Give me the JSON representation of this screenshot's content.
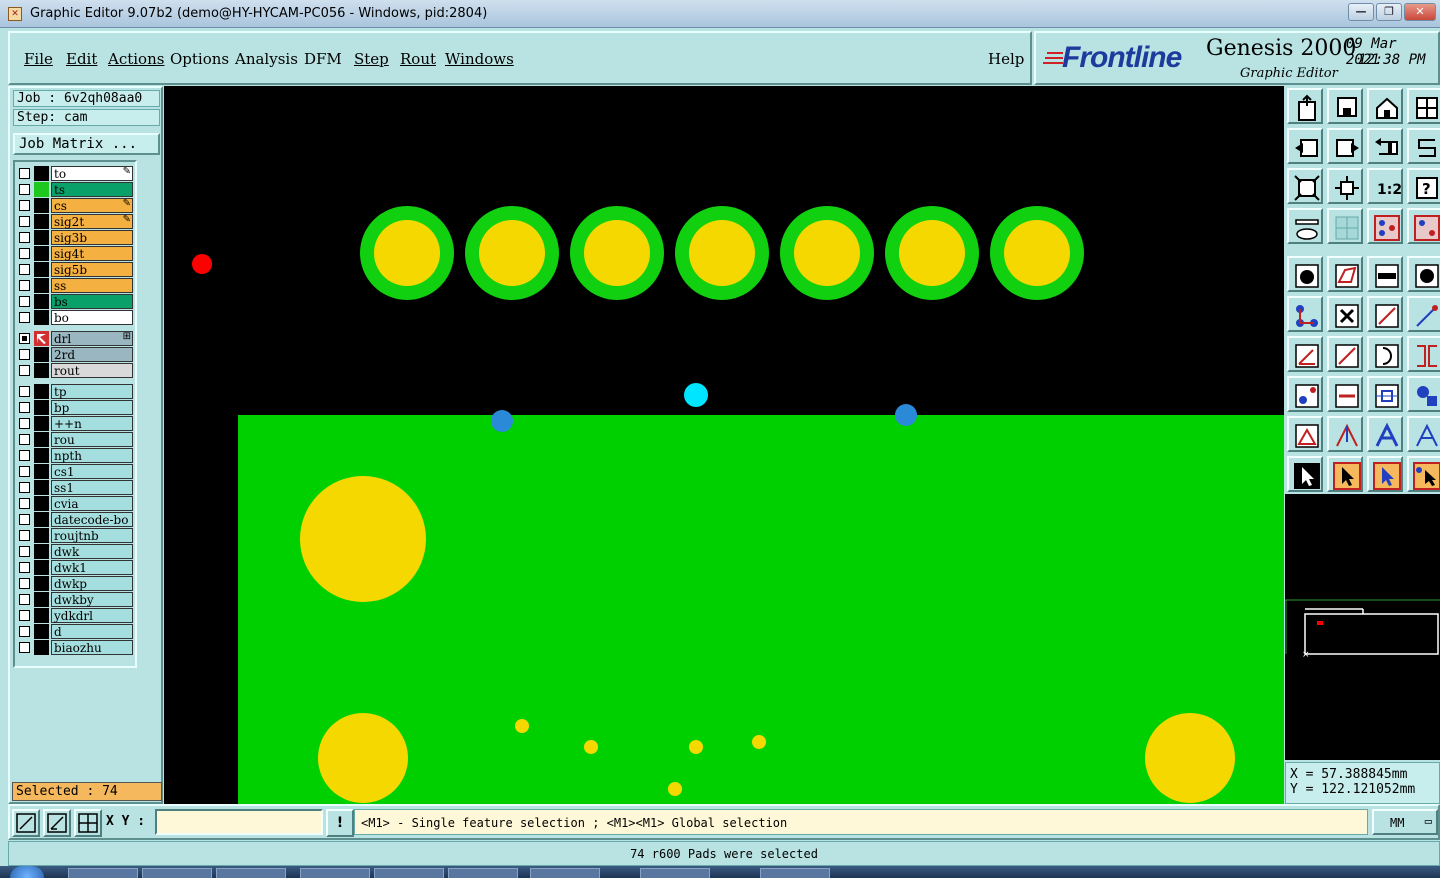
{
  "window": {
    "title": "Graphic Editor 9.07b2 (demo@HY-HYCAM-PC056 - Windows, pid:2804)",
    "minimize_label": "—",
    "maximize_label": "❐",
    "close_label": "✕",
    "close_color": "#c9473b"
  },
  "menu": {
    "file": "File",
    "edit": "Edit",
    "actions": "Actions",
    "options": "Options",
    "analysis": "Analysis",
    "dfm": "DFM",
    "step": "Step",
    "rout": "Rout",
    "windows": "Windows",
    "help": "Help"
  },
  "brand": {
    "logo": "Frontline",
    "product": "Genesis 2000",
    "subtitle": "Graphic Editor",
    "date": "09 Mar 2021",
    "time": "12:38 PM",
    "logo_color": "#1d3b9c"
  },
  "job": {
    "job_label": "Job : 6v2qh08aa0",
    "step_label": "Step: cam",
    "matrix_button": "Job Matrix ..."
  },
  "layers": {
    "board": [
      {
        "name": "to",
        "color": "#ffffff",
        "checked": false,
        "mark": "✎"
      },
      {
        "name": "ts",
        "color": "#0aa06a",
        "checked": false,
        "green": true
      },
      {
        "name": "cs",
        "color": "#f5b042",
        "checked": false,
        "mark": "✎"
      },
      {
        "name": "sig2t",
        "color": "#f5b042",
        "checked": false,
        "mark": "✎"
      },
      {
        "name": "sig3b",
        "color": "#f5b042",
        "checked": false
      },
      {
        "name": "sig4t",
        "color": "#f5b042",
        "checked": false
      },
      {
        "name": "sig5b",
        "color": "#f5b042",
        "checked": false
      },
      {
        "name": "ss",
        "color": "#f5b042",
        "checked": false
      },
      {
        "name": "bs",
        "color": "#0aa06a",
        "checked": false
      },
      {
        "name": "bo",
        "color": "#ffffff",
        "checked": false
      }
    ],
    "drill": [
      {
        "name": "drl",
        "color": "#9ab6c0",
        "checked": true,
        "mark": "⊞"
      },
      {
        "name": "2rd",
        "color": "#9ab6c0",
        "checked": false
      },
      {
        "name": "rout",
        "color": "#d9d9d9",
        "checked": false
      }
    ],
    "misc": [
      {
        "name": "tp",
        "color": "#a4dede",
        "checked": false
      },
      {
        "name": "bp",
        "color": "#a4dede",
        "checked": false
      },
      {
        "name": "++n",
        "color": "#a4dede",
        "checked": false
      },
      {
        "name": "rou",
        "color": "#a4dede",
        "checked": false
      },
      {
        "name": "npth",
        "color": "#a4dede",
        "checked": false
      },
      {
        "name": "cs1",
        "color": "#a4dede",
        "checked": false
      },
      {
        "name": "ss1",
        "color": "#a4dede",
        "checked": false
      },
      {
        "name": "cvia",
        "color": "#a4dede",
        "checked": false
      },
      {
        "name": "datecode-bo",
        "color": "#a4dede",
        "checked": false
      },
      {
        "name": "roujtnb",
        "color": "#a4dede",
        "checked": false
      },
      {
        "name": "dwk",
        "color": "#a4dede",
        "checked": false
      },
      {
        "name": "dwk1",
        "color": "#a4dede",
        "checked": false
      },
      {
        "name": "dwkp",
        "color": "#a4dede",
        "checked": false
      },
      {
        "name": "dwkby",
        "color": "#a4dede",
        "checked": false
      },
      {
        "name": "ydkdrl",
        "color": "#a4dede",
        "checked": false
      },
      {
        "name": "d",
        "color": "#a4dede",
        "checked": false
      },
      {
        "name": "biaozhu",
        "color": "#a4dede",
        "checked": false
      }
    ]
  },
  "selected_label": "Selected : 74",
  "coords": {
    "x": "X = 57.388845mm",
    "y": "Y = 122.121052mm"
  },
  "command": {
    "xy_label": "X Y :",
    "xy_value": "",
    "message": "<M1> - Single feature selection ; <M1><M1> Global selection",
    "units": "MM",
    "bang": "!"
  },
  "status": "74 r600 Pads were selected",
  "tools": {
    "ratio_label": "1:2",
    "help_label": "?"
  },
  "colors": {
    "panel": "#b9e3e3",
    "copper": "#00d000",
    "pad": "#f5d800",
    "drill_cyan": "#00e5ff",
    "drill_blue": "#2b8ad8",
    "highlight": "#ff0000",
    "selected_bg": "#f5b85c"
  }
}
